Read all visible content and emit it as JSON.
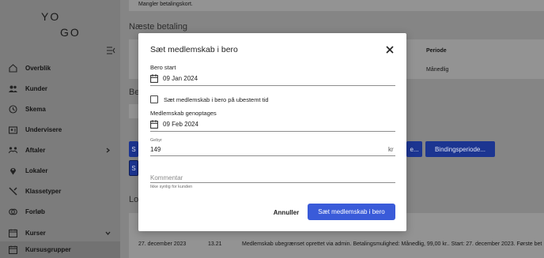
{
  "app": {
    "logo_line1": "YO",
    "logo_line2": "GO"
  },
  "sidebar": {
    "items": [
      {
        "label": "Overblik",
        "icon": "home-icon"
      },
      {
        "label": "Kunder",
        "icon": "users-icon"
      },
      {
        "label": "Skema",
        "icon": "clock-icon"
      },
      {
        "label": "Undervisere",
        "icon": "id-card-icon"
      },
      {
        "label": "Aftaler",
        "icon": "handshake-icon",
        "has_chevron": "right"
      },
      {
        "label": "Lokaler",
        "icon": "location-pin-icon"
      },
      {
        "label": "Klassetyper",
        "icon": "tools-icon"
      },
      {
        "label": "Forløb",
        "icon": "rings-icon"
      },
      {
        "label": "Kurser",
        "icon": "calendar-icon",
        "has_chevron": "down"
      },
      {
        "label": "Kursusgrupper",
        "icon": "calendar-icon",
        "active": true
      }
    ]
  },
  "background": {
    "payment_missing": "Mangler betalingskort.",
    "next_payment_heading": "Næste betaling",
    "period_col_header": "Periode",
    "period_value": "Månedlig",
    "partial_heading_b": "Be",
    "partial_heading_lo": "Lo",
    "partial_btn_s1": "S",
    "partial_btn_s2": "S",
    "btn_partial_e": "e...",
    "btn_binding": "Bindingsperiode...",
    "log_row": {
      "date": "27. december 2023",
      "time": "13.21",
      "text": "Medlemskab ubegrænset oprettet via admin. Betalingsmulighed: Månedlig, 99,00 kr.. Start: 27. december 2023. Første bet"
    }
  },
  "modal": {
    "title": "Sæt medlemskab i bero",
    "bero_start_label": "Bero start",
    "bero_start_value": "09 Jan 2024",
    "indefinite_label": "Sæt medlemskab i bero på ubestemt tid",
    "indefinite_checked": false,
    "resume_label": "Medlemskab genoptages",
    "resume_value": "09 Feb 2024",
    "fee_label": "Gebyr",
    "fee_value": "149",
    "fee_unit": "kr",
    "comment_placeholder": "Kommentar",
    "comment_value": "",
    "comment_hint": "Ikke synlig for kunden",
    "cancel_label": "Annuller",
    "submit_label": "Sæt medlemskab i bero"
  },
  "colors": {
    "primary": "#3a5bd9",
    "overlay_button": "#1c3591"
  }
}
